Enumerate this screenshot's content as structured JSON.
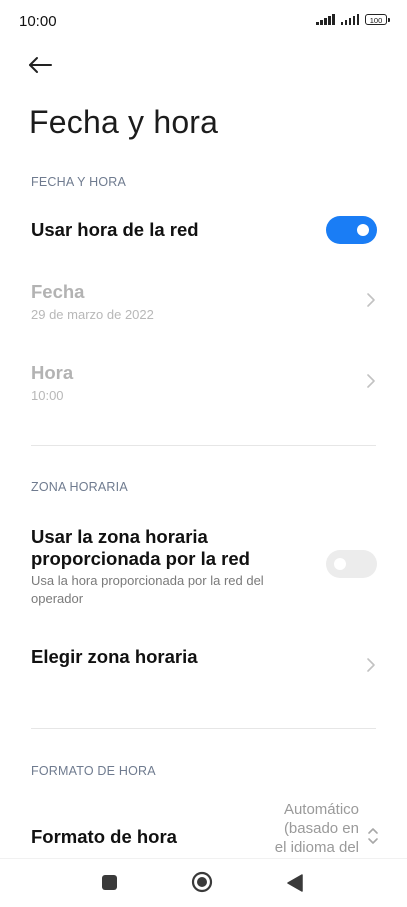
{
  "status_bar": {
    "time": "10:00",
    "battery": "100"
  },
  "page": {
    "title": "Fecha y hora"
  },
  "sections": {
    "date_time": {
      "header": "FECHA Y HORA",
      "use_network_time": {
        "label": "Usar hora de la red",
        "enabled": true
      },
      "date": {
        "label": "Fecha",
        "value": "29 de marzo de 2022"
      },
      "time": {
        "label": "Hora",
        "value": "10:00"
      }
    },
    "time_zone": {
      "header": "ZONA HORARIA",
      "use_network_zone": {
        "label_line1": "Usar la zona horaria",
        "label_line2": "proporcionada por la red",
        "desc_line1": "Usa la hora proporcionada por la red del",
        "desc_line2": "operador",
        "enabled": false
      },
      "choose_zone": {
        "label": "Elegir zona horaria"
      }
    },
    "format": {
      "header": "FORMATO DE HORA",
      "time_format": {
        "label": "Formato de hora",
        "value_line1": "Automático",
        "value_line2": "(basado en",
        "value_line3": "el idioma del"
      }
    }
  },
  "colors": {
    "accent": "#1a7df5",
    "section_header": "#6f7b8f",
    "disabled_text": "#b3b3b3"
  },
  "icons": {
    "back": "arrow-left-icon",
    "chevron": "chevron-right-icon",
    "nav_recents": "square-icon",
    "nav_home": "circle-icon",
    "nav_back": "triangle-back-icon"
  }
}
